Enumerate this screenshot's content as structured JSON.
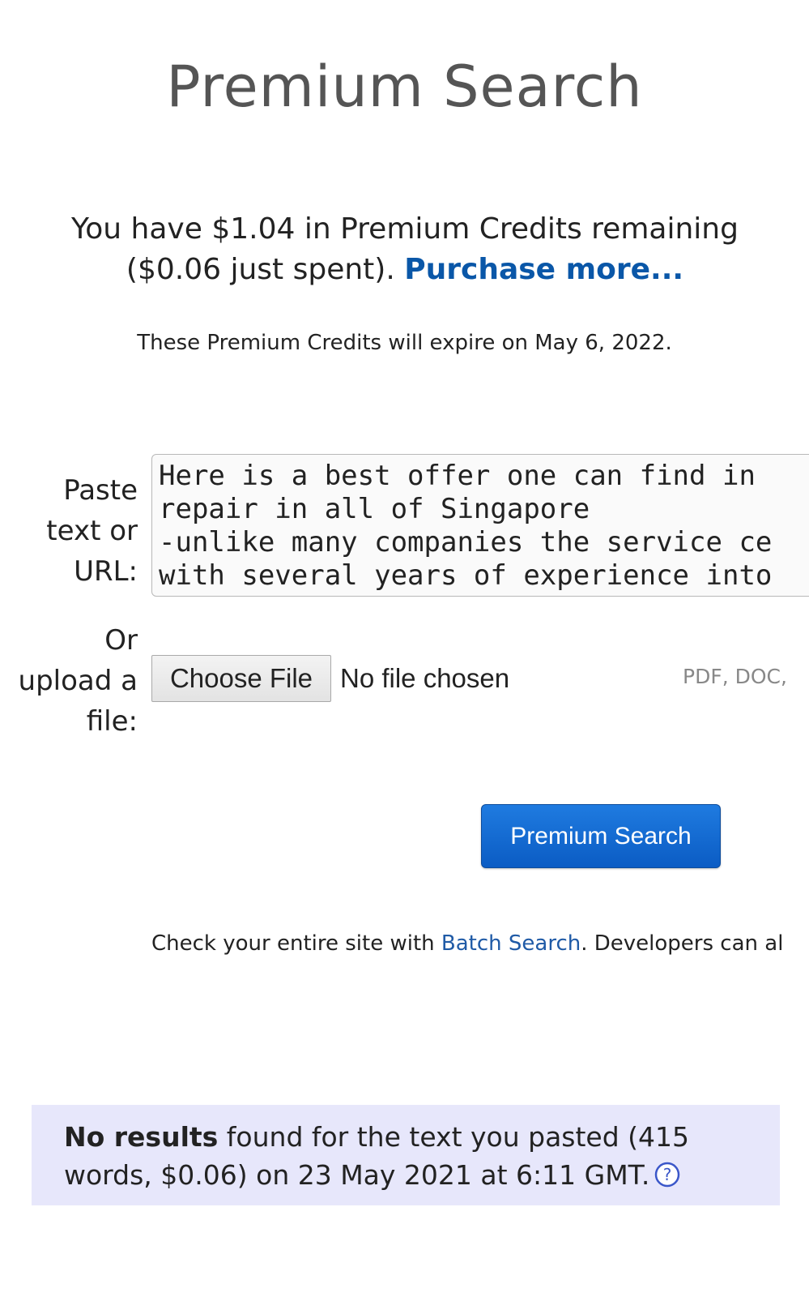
{
  "page": {
    "title": "Premium Search"
  },
  "credits": {
    "text": "You have $1.04 in Premium Credits remaining ($0.06 just spent).",
    "purchase_link": "Purchase more...",
    "expire_text": "These Premium Credits will expire on May 6, 2022."
  },
  "form": {
    "paste_label": "Paste text or URL:",
    "textarea_value": "Here is a best offer one can find in\nrepair in all of Singapore\n-unlike many companies the service ce\nwith several years of experience into\nfar and wide the best service provide",
    "upload_label": "Or upload a file:",
    "choose_file_label": "Choose File",
    "no_file_text": "No file chosen",
    "file_types": "PDF, DOC,",
    "search_button_label": "Premium Search"
  },
  "batch": {
    "prefix": "Check your entire site with ",
    "link": "Batch Search",
    "suffix": ". Developers can also"
  },
  "results": {
    "bold": "No results",
    "text": " found for the text you pasted (415 words, $0.06) on 23 May 2021 at 6:11 GMT.",
    "help_icon": "question-circle-icon"
  },
  "colors": {
    "link": "#0a57a8",
    "button": "#1f7be0",
    "results_bg": "#e7e7fb"
  }
}
